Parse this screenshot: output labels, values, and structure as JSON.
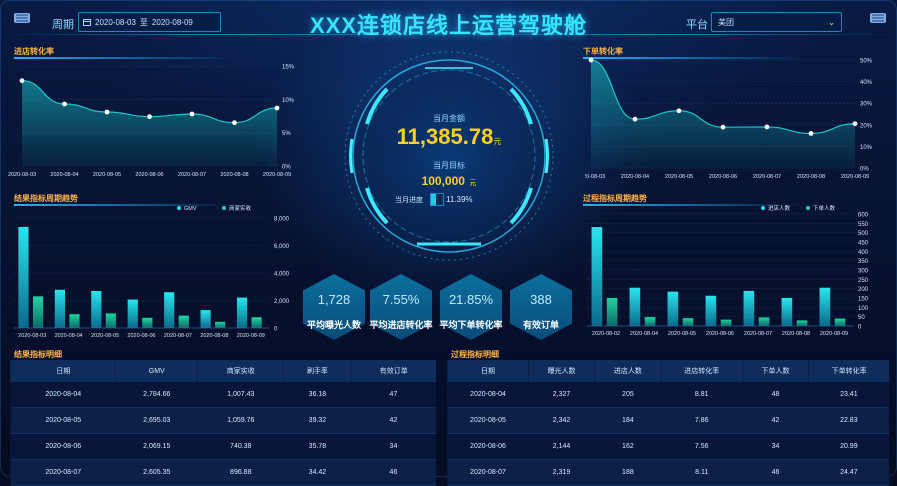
{
  "header": {
    "title": "XXX连锁店线上运营驾驶舱",
    "period_label": "周期",
    "date_start": "2020-08-03",
    "date_sep": "至",
    "date_end": "2020-08-09",
    "platform_label": "平台",
    "platform_value": "美团"
  },
  "center": {
    "amount_label": "当月金额",
    "amount_value": "11,385.78",
    "amount_unit": "元",
    "target_label": "当月目标",
    "target_value": "100,000",
    "target_unit": "元",
    "progress_label": "当月进度",
    "progress_value": "11.39%",
    "progress_fraction": 0.1139
  },
  "kpis": [
    {
      "value": "1,728",
      "label": "平均曝光人数"
    },
    {
      "value": "7.55%",
      "label": "平均进店转化率"
    },
    {
      "value": "21.85%",
      "label": "平均下单转化率"
    },
    {
      "value": "388",
      "label": "有效订单"
    }
  ],
  "panels": {
    "store_conv": "进店转化率",
    "order_conv": "下单转化率",
    "result_trend": "结果指标周期趋势",
    "process_trend": "过程指标周期趋势",
    "result_detail": "结果指标明细",
    "process_detail": "过程指标明细"
  },
  "chart_data": [
    {
      "type": "area",
      "title": "进店转化率",
      "x": [
        "2020-08-03",
        "2020-08-04",
        "2020-08-05",
        "2020-08-06",
        "2020-08-07",
        "2020-08-08",
        "2020-08-09"
      ],
      "values": [
        12.8,
        9.3,
        8.1,
        7.4,
        7.8,
        6.5,
        8.7
      ],
      "ylim": [
        0,
        15
      ],
      "yticks": [
        "0%",
        "5%",
        "10%",
        "15%"
      ],
      "ytick_vals": [
        0,
        5,
        10,
        15
      ],
      "color": "#18c6c8"
    },
    {
      "type": "area",
      "title": "下单转化率",
      "x": [
        "2020-08-03",
        "2020-08-04",
        "2020-08-05",
        "2020-08-06",
        "2020-08-07",
        "2020-08-08",
        "2020-08-09"
      ],
      "values": [
        50,
        22.6,
        26.5,
        18.9,
        19,
        16,
        20.5
      ],
      "ylim": [
        0,
        50
      ],
      "yticks": [
        "0%",
        "10%",
        "20%",
        "30%",
        "40%",
        "50%"
      ],
      "ytick_vals": [
        0,
        10,
        20,
        30,
        40,
        50
      ],
      "color": "#18c6c8"
    },
    {
      "type": "bar",
      "title": "结果指标周期趋势",
      "categories": [
        "2020-08-03",
        "2020-08-04",
        "2020-08-05",
        "2020-08-06",
        "2020-08-07",
        "2020-08-08",
        "2020-08-09"
      ],
      "series": [
        {
          "name": "GMV",
          "values": [
            7350,
            2780,
            2690,
            2070,
            2600,
            1300,
            2210
          ]
        },
        {
          "name": "商家实收",
          "values": [
            2300,
            1000,
            1060,
            740,
            900,
            450,
            780
          ]
        }
      ],
      "ylim": [
        0,
        8000
      ],
      "yticks": [
        "0",
        "2,000",
        "4,000",
        "6,000",
        "8,000"
      ],
      "ytick_vals": [
        0,
        2000,
        4000,
        6000,
        8000
      ],
      "legend": "top-right"
    },
    {
      "type": "bar",
      "title": "过程指标周期趋势",
      "categories": [
        "2020-08-02",
        "2020-08-04",
        "2020-08-05",
        "2020-08-06",
        "2020-08-07",
        "2020-08-08",
        "2020-08-09"
      ],
      "series": [
        {
          "name": "进店人数",
          "values": [
            530,
            205,
            184,
            162,
            188,
            150,
            205
          ]
        },
        {
          "name": "下单人数",
          "values": [
            150,
            48,
            42,
            34,
            46,
            30,
            40
          ]
        }
      ],
      "ylim": [
        0,
        600
      ],
      "yticks": [
        "0",
        "50",
        "100",
        "150",
        "200",
        "250",
        "300",
        "350",
        "400",
        "450",
        "500",
        "550",
        "600"
      ],
      "ytick_vals": [
        0,
        50,
        100,
        150,
        200,
        250,
        300,
        350,
        400,
        450,
        500,
        550,
        600
      ],
      "legend": "top-right"
    }
  ],
  "result_table": {
    "headers": [
      "日期",
      "GMV",
      "商家实收",
      "刷手率",
      "有效订单"
    ],
    "rows": [
      [
        "2020-08-04",
        "2,784.66",
        "1,007.43",
        "36.18",
        "47"
      ],
      [
        "2020-08-05",
        "2,695.03",
        "1,059.76",
        "39.32",
        "42"
      ],
      [
        "2020-08-06",
        "2,069.15",
        "740.38",
        "35.78",
        "34"
      ],
      [
        "2020-08-07",
        "2,605.35",
        "896.88",
        "34.42",
        "46"
      ]
    ]
  },
  "process_table": {
    "headers": [
      "日期",
      "曝光人数",
      "进店人数",
      "进店转化率",
      "下单人数",
      "下单转化率"
    ],
    "rows": [
      [
        "2020-08-04",
        "2,327",
        "205",
        "8.81",
        "48",
        "23.41"
      ],
      [
        "2020-08-05",
        "2,342",
        "184",
        "7.86",
        "42",
        "22.83"
      ],
      [
        "2020-08-06",
        "2,144",
        "162",
        "7.56",
        "34",
        "20.99"
      ],
      [
        "2020-08-07",
        "2,319",
        "188",
        "8.11",
        "46",
        "24.47"
      ]
    ]
  },
  "colors": {
    "accent": "#18c6c8",
    "title": "#37e4ff",
    "gold": "#ffd21f",
    "panel_title": "#ffb34a"
  }
}
